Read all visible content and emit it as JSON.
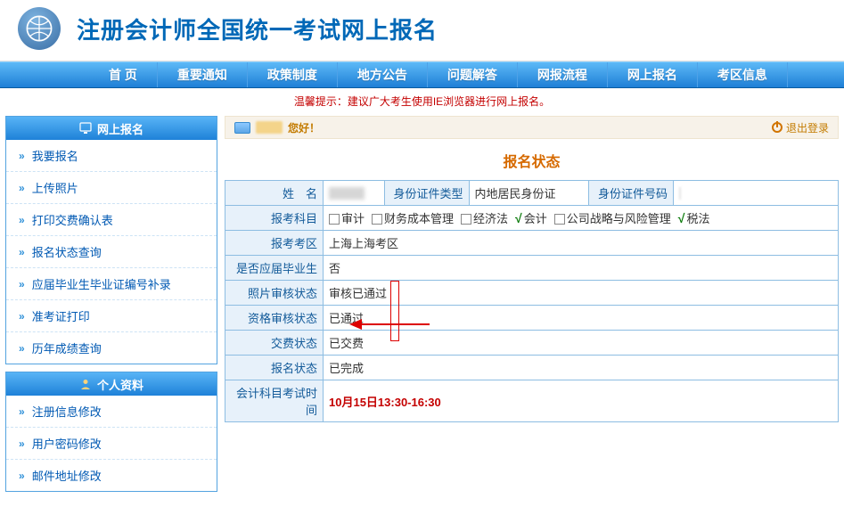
{
  "header": {
    "site_title": "注册会计师全国统一考试网上报名"
  },
  "nav": {
    "items": [
      "首 页",
      "重要通知",
      "政策制度",
      "地方公告",
      "问题解答",
      "网报流程",
      "网上报名",
      "考区信息"
    ]
  },
  "tip": "温馨提示：建议广大考生使用IE浏览器进行网上报名。",
  "sidebar": {
    "panel1": {
      "title": "网上报名",
      "items": [
        {
          "label": "我要报名"
        },
        {
          "label": "上传照片"
        },
        {
          "label": "打印交费确认表"
        },
        {
          "label": "报名状态查询"
        },
        {
          "label": "应届毕业生毕业证编号补录"
        },
        {
          "label": "准考证打印"
        },
        {
          "label": "历年成绩查询"
        }
      ]
    },
    "panel2": {
      "title": "个人资料",
      "items": [
        {
          "label": "注册信息修改"
        },
        {
          "label": "用户密码修改"
        },
        {
          "label": "邮件地址修改"
        }
      ]
    }
  },
  "greet": {
    "hello": "您好！",
    "logout": "退出登录"
  },
  "main": {
    "title": "报名状态",
    "rows": {
      "name_lbl": "姓　名",
      "name_val": "",
      "id_type_lbl": "身份证件类型",
      "id_type_val": "内地居民身份证",
      "id_no_lbl": "身份证件号码",
      "id_no_val": "",
      "subjects_lbl": "报考科目",
      "subjects": [
        {
          "label": "审计",
          "checked": false
        },
        {
          "label": "财务成本管理",
          "checked": false
        },
        {
          "label": "经济法",
          "checked": false
        },
        {
          "label": "会计",
          "checked": true
        },
        {
          "label": "公司战略与风险管理",
          "checked": false
        },
        {
          "label": "税法",
          "checked": true
        }
      ],
      "area_lbl": "报考考区",
      "area_val": "上海上海考区",
      "grad_lbl": "是否应届毕业生",
      "grad_val": "否",
      "photo_lbl": "照片审核状态",
      "photo_val": "审核已通过",
      "qual_lbl": "资格审核状态",
      "qual_val": "已通过",
      "pay_lbl": "交费状态",
      "pay_val": "已交费",
      "status_lbl": "报名状态",
      "status_val": "已完成",
      "exam_time_lbl": "会计科目考试时间",
      "exam_time_val": "10月15日13:30-16:30"
    }
  }
}
